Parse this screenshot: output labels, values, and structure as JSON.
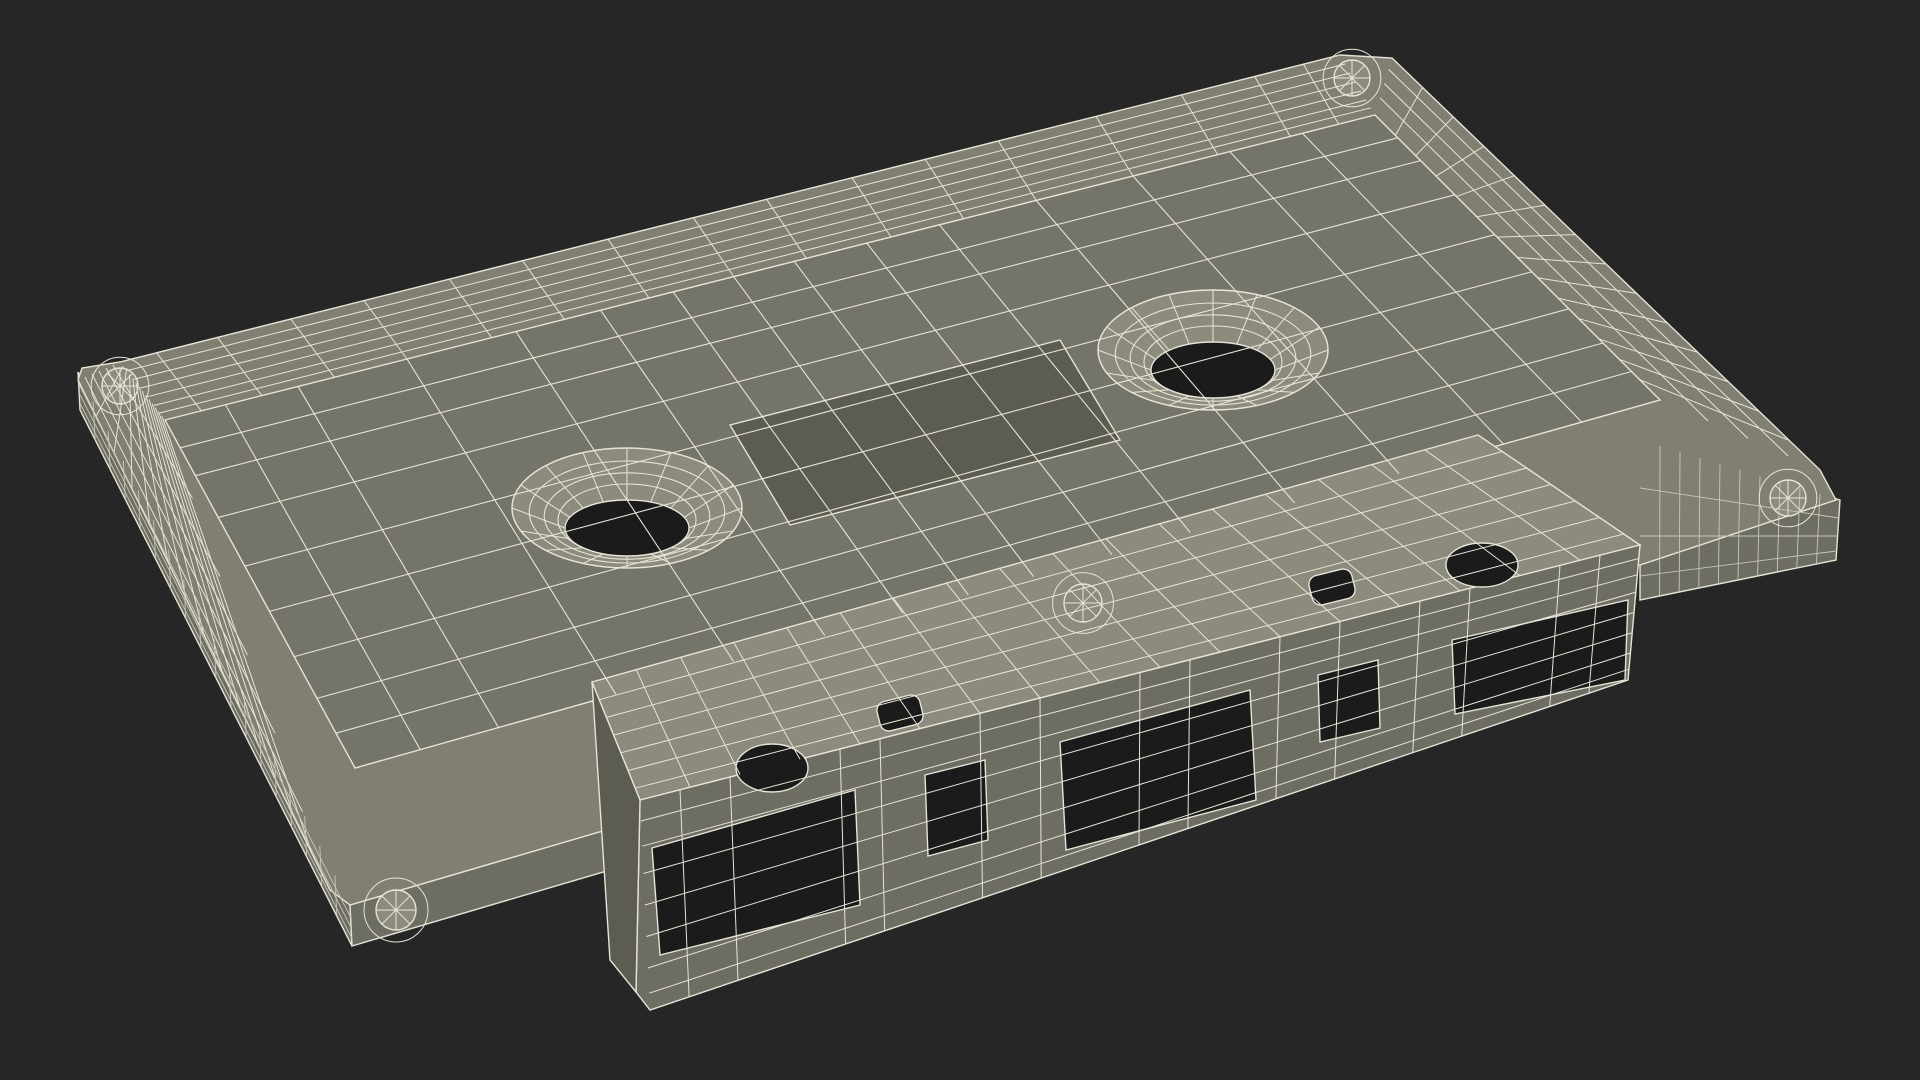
{
  "scene": {
    "subject": "cassette-tape-wireframe",
    "view": "3d-viewport-render"
  },
  "colors": {
    "background": "#262626",
    "surface_top": "#807f72",
    "surface_light": "#8d8b7e",
    "surface_mid": "#75746a",
    "surface_dark": "#5d5c53",
    "side_face": "#6e6d63",
    "hole_dark": "#1b1b1b",
    "wire": "#e6e4d4",
    "wire_dim": "#c9c7b7"
  }
}
